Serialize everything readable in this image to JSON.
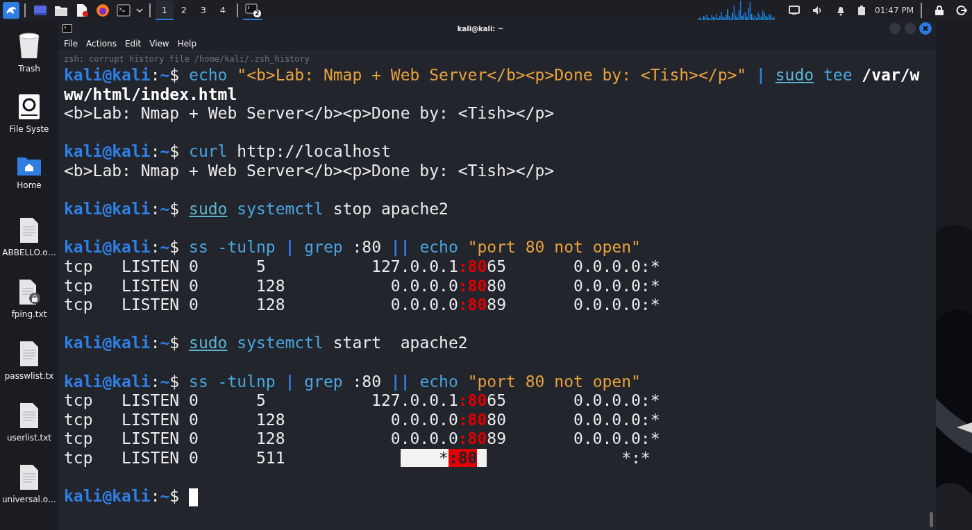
{
  "taskbar": {
    "launchers": [
      {
        "kind": "desktop"
      },
      {
        "kind": "files"
      },
      {
        "kind": "editor"
      },
      {
        "kind": "browser"
      },
      {
        "kind": "terminal"
      }
    ],
    "workspaces": [
      {
        "label": "1",
        "selected": true
      },
      {
        "label": "2",
        "selected": false
      },
      {
        "label": "3",
        "selected": false
      },
      {
        "label": "4",
        "selected": false
      }
    ],
    "task": {
      "badge": "2"
    },
    "clock": "01:47 PM"
  },
  "desktop_icons": [
    {
      "kind": "trash",
      "label": "Trash"
    },
    {
      "kind": "drive",
      "label": "File Syste"
    },
    {
      "kind": "home",
      "label": "Home"
    },
    {
      "kind": "doc",
      "label": "ABBELLO.o…"
    },
    {
      "kind": "locked",
      "label": "fping.txt"
    },
    {
      "kind": "doc",
      "label": "passwlist.tx"
    },
    {
      "kind": "doc",
      "label": "userlist.txt"
    },
    {
      "kind": "doc",
      "label": "universal.o…"
    }
  ],
  "window": {
    "title": "kali@kali: ~",
    "menu": [
      "File",
      "Actions",
      "Edit",
      "View",
      "Help"
    ]
  },
  "terminal": {
    "faint_line": "zsh: corrupt history file /home/kali/.zsh_history",
    "blocks": [
      [
        {
          "segments": [
            {
              "kind": "user",
              "text": "kali@kali"
            },
            {
              "kind": "plain",
              "text": ":"
            },
            {
              "kind": "user",
              "text": "~"
            },
            {
              "kind": "plain",
              "text": "$ "
            },
            {
              "kind": "cmd",
              "text": "echo"
            },
            {
              "kind": "str",
              "text": " \"<b>Lab: Nmap + Web Server</b><p>Done by: <Tish></p>\""
            },
            {
              "kind": "op",
              "text": " | "
            },
            {
              "kind": "sudo",
              "text": "sudo"
            },
            {
              "kind": "cmd",
              "text": " tee"
            },
            {
              "kind": "bold",
              "text": " /var/w"
            }
          ]
        },
        {
          "segments": [
            {
              "kind": "bold",
              "text": "ww/html/index.html"
            }
          ]
        },
        {
          "segments": [
            {
              "kind": "plain",
              "text": "<b>Lab: Nmap + Web Server</b><p>Done by: <Tish></p>"
            }
          ]
        }
      ],
      [
        {
          "segments": [
            {
              "kind": "user",
              "text": "kali@kali"
            },
            {
              "kind": "plain",
              "text": ":"
            },
            {
              "kind": "user",
              "text": "~"
            },
            {
              "kind": "plain",
              "text": "$ "
            },
            {
              "kind": "cmd",
              "text": "curl"
            },
            {
              "kind": "plain",
              "text": " http://localhost"
            }
          ]
        },
        {
          "segments": [
            {
              "kind": "plain",
              "text": "<b>Lab: Nmap + Web Server</b><p>Done by: <Tish></p>"
            }
          ]
        }
      ],
      [
        {
          "segments": [
            {
              "kind": "user",
              "text": "kali@kali"
            },
            {
              "kind": "plain",
              "text": ":"
            },
            {
              "kind": "user",
              "text": "~"
            },
            {
              "kind": "plain",
              "text": "$ "
            },
            {
              "kind": "sudo",
              "text": "sudo"
            },
            {
              "kind": "cmd",
              "text": " systemctl"
            },
            {
              "kind": "plain",
              "text": " stop apache2"
            }
          ]
        }
      ],
      [
        {
          "segments": [
            {
              "kind": "user",
              "text": "kali@kali"
            },
            {
              "kind": "plain",
              "text": ":"
            },
            {
              "kind": "user",
              "text": "~"
            },
            {
              "kind": "plain",
              "text": "$ "
            },
            {
              "kind": "cmd",
              "text": "ss -tulnp"
            },
            {
              "kind": "op",
              "text": " |"
            },
            {
              "kind": "cmd",
              "text": " grep"
            },
            {
              "kind": "plain",
              "text": " :80"
            },
            {
              "kind": "op",
              "text": " ||"
            },
            {
              "kind": "cmd",
              "text": " echo"
            },
            {
              "kind": "str",
              "text": " \"port 80 not open\""
            }
          ]
        },
        {
          "segments": [
            {
              "kind": "plain",
              "text": "tcp   LISTEN 0      5           127.0.0.1"
            },
            {
              "kind": "match",
              "text": ":80"
            },
            {
              "kind": "plain",
              "text": "65       0.0.0.0:*"
            }
          ]
        },
        {
          "segments": [
            {
              "kind": "plain",
              "text": "tcp   LISTEN 0      128           0.0.0.0"
            },
            {
              "kind": "match",
              "text": ":80"
            },
            {
              "kind": "plain",
              "text": "80       0.0.0.0:*"
            }
          ]
        },
        {
          "segments": [
            {
              "kind": "plain",
              "text": "tcp   LISTEN 0      128           0.0.0.0"
            },
            {
              "kind": "match",
              "text": ":80"
            },
            {
              "kind": "plain",
              "text": "89       0.0.0.0:*"
            }
          ]
        }
      ],
      [
        {
          "segments": [
            {
              "kind": "user",
              "text": "kali@kali"
            },
            {
              "kind": "plain",
              "text": ":"
            },
            {
              "kind": "user",
              "text": "~"
            },
            {
              "kind": "plain",
              "text": "$ "
            },
            {
              "kind": "sudo",
              "text": "sudo"
            },
            {
              "kind": "cmd",
              "text": " systemctl"
            },
            {
              "kind": "plain",
              "text": " start  apache2"
            }
          ]
        }
      ],
      [
        {
          "segments": [
            {
              "kind": "user",
              "text": "kali@kali"
            },
            {
              "kind": "plain",
              "text": ":"
            },
            {
              "kind": "user",
              "text": "~"
            },
            {
              "kind": "plain",
              "text": "$ "
            },
            {
              "kind": "cmd",
              "text": "ss -tulnp"
            },
            {
              "kind": "op",
              "text": " |"
            },
            {
              "kind": "cmd",
              "text": " grep"
            },
            {
              "kind": "plain",
              "text": " :80"
            },
            {
              "kind": "op",
              "text": " ||"
            },
            {
              "kind": "cmd",
              "text": " echo"
            },
            {
              "kind": "str",
              "text": " \"port 80 not open\""
            }
          ]
        },
        {
          "segments": [
            {
              "kind": "plain",
              "text": "tcp   LISTEN 0      5           127.0.0.1"
            },
            {
              "kind": "match",
              "text": ":80"
            },
            {
              "kind": "plain",
              "text": "65       0.0.0.0:*"
            }
          ]
        },
        {
          "segments": [
            {
              "kind": "plain",
              "text": "tcp   LISTEN 0      128           0.0.0.0"
            },
            {
              "kind": "match",
              "text": ":80"
            },
            {
              "kind": "plain",
              "text": "80       0.0.0.0:*"
            }
          ]
        },
        {
          "segments": [
            {
              "kind": "plain",
              "text": "tcp   LISTEN 0      128           0.0.0.0"
            },
            {
              "kind": "match",
              "text": ":80"
            },
            {
              "kind": "plain",
              "text": "89       0.0.0.0:*"
            }
          ]
        },
        {
          "segments": [
            {
              "kind": "plain",
              "text": "tcp   LISTEN 0      511            "
            },
            {
              "kind": "hl",
              "text": "    *"
            },
            {
              "kind": "hl_match",
              "text": ":80"
            },
            {
              "kind": "plain",
              "text": "               *:*"
            }
          ]
        }
      ],
      [
        {
          "cursor": true,
          "segments": [
            {
              "kind": "user",
              "text": "kali@kali"
            },
            {
              "kind": "plain",
              "text": ":"
            },
            {
              "kind": "user",
              "text": "~"
            },
            {
              "kind": "plain",
              "text": "$ "
            }
          ]
        }
      ]
    ]
  }
}
